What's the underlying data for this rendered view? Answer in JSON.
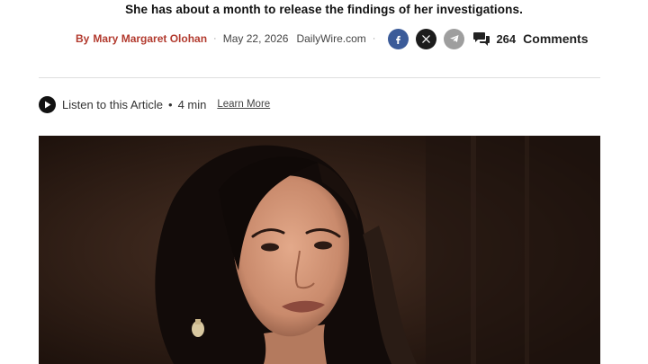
{
  "article": {
    "subheadline": "She has about a month to release the findings of her investigations."
  },
  "byline": {
    "prefix": "By",
    "author": "Mary Margaret Olohan",
    "separator": "·",
    "date": "May 22, 2026",
    "source": "DailyWire.com"
  },
  "share": {
    "icons": [
      "facebook-icon",
      "x-icon",
      "telegram-icon"
    ],
    "colors": {
      "facebook": "#3b5b99",
      "x": "#1c1c1c",
      "telegram": "#9e9e9e"
    }
  },
  "comments": {
    "count": "264",
    "label": "Comments"
  },
  "audio": {
    "label": "Listen to this Article",
    "separator": "•",
    "duration": "4 min",
    "learn_more": "Learn More"
  },
  "accent_color": "#b23a2e"
}
